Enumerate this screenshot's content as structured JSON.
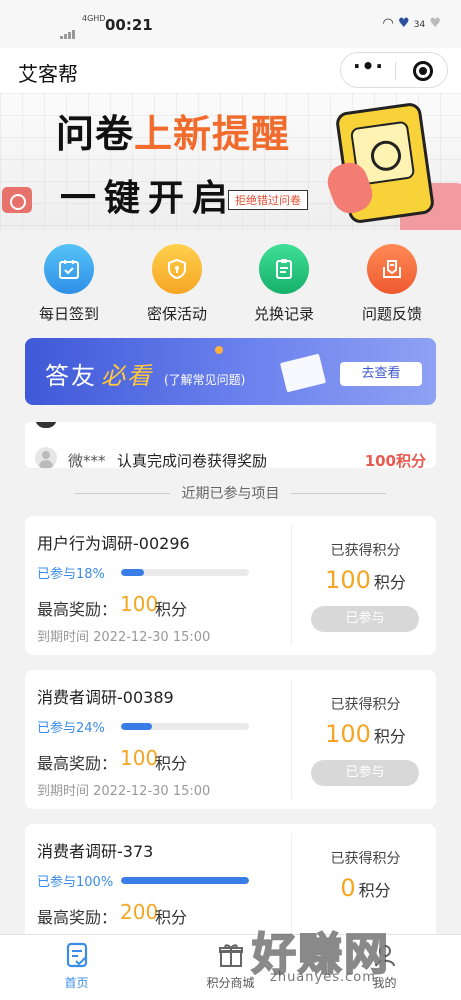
{
  "status_bar": {
    "time": "00:21",
    "network": "4GHD",
    "battery": "34"
  },
  "navbar": {
    "title": "艾客帮"
  },
  "banner": {
    "line1_part1": "问卷",
    "line1_part2": "上新提醒",
    "line2": "一键开启",
    "tag": "拒绝错过问卷"
  },
  "quick_actions": [
    {
      "label": "每日签到",
      "icon": "calendar-check-icon",
      "color": "#3aa8f0"
    },
    {
      "label": "密保活动",
      "icon": "shield-icon",
      "color": "#f7b52a"
    },
    {
      "label": "兑换记录",
      "icon": "clipboard-list-icon",
      "color": "#22c47e"
    },
    {
      "label": "问题反馈",
      "icon": "feedback-icon",
      "color": "#f26a3c"
    }
  ],
  "notice_banner": {
    "title_part1": "答友",
    "title_part2": "必看",
    "subtitle": "(了解常见问题)",
    "button": "去查看"
  },
  "activity_feed": {
    "user": "微***",
    "text": "认真完成问卷获得奖励",
    "points": "100积分"
  },
  "section_title": "近期已参与项目",
  "projects": [
    {
      "name": "用户行为调研-00296",
      "joined_label": "已参与18%",
      "progress": 0.18,
      "reward_label": "最高奖励：",
      "reward_value": "100",
      "reward_unit": "积分",
      "expiry": "到期时间 2022-12-30 15:00",
      "earned_label": "已获得积分",
      "earned_value": "100",
      "earned_unit": "积分",
      "status_button": "已参与"
    },
    {
      "name": "消费者调研-00389",
      "joined_label": "已参与24%",
      "progress": 0.24,
      "reward_label": "最高奖励：",
      "reward_value": "100",
      "reward_unit": "积分",
      "expiry": "到期时间 2022-12-30 15:00",
      "earned_label": "已获得积分",
      "earned_value": "100",
      "earned_unit": "积分",
      "status_button": "已参与"
    },
    {
      "name": "消费者调研-373",
      "joined_label": "已参与100%",
      "progress": 1.0,
      "reward_label": "最高奖励：",
      "reward_value": "200",
      "reward_unit": "积分",
      "expiry": "",
      "earned_label": "已获得积分",
      "earned_value": "0",
      "earned_unit": "积分",
      "status_button": ""
    }
  ],
  "tab_bar": [
    {
      "label": "首页",
      "icon": "home-doc-icon",
      "active": true
    },
    {
      "label": "积分商城",
      "icon": "gift-icon",
      "active": false
    },
    {
      "label": "我的",
      "icon": "user-icon",
      "active": false
    }
  ],
  "watermark": {
    "main": "好赚网",
    "sub": "zhuanyes.com"
  },
  "colors": {
    "accent_blue": "#3a8ce8",
    "reward_orange": "#f4a623",
    "points_red": "#e85a4f"
  }
}
